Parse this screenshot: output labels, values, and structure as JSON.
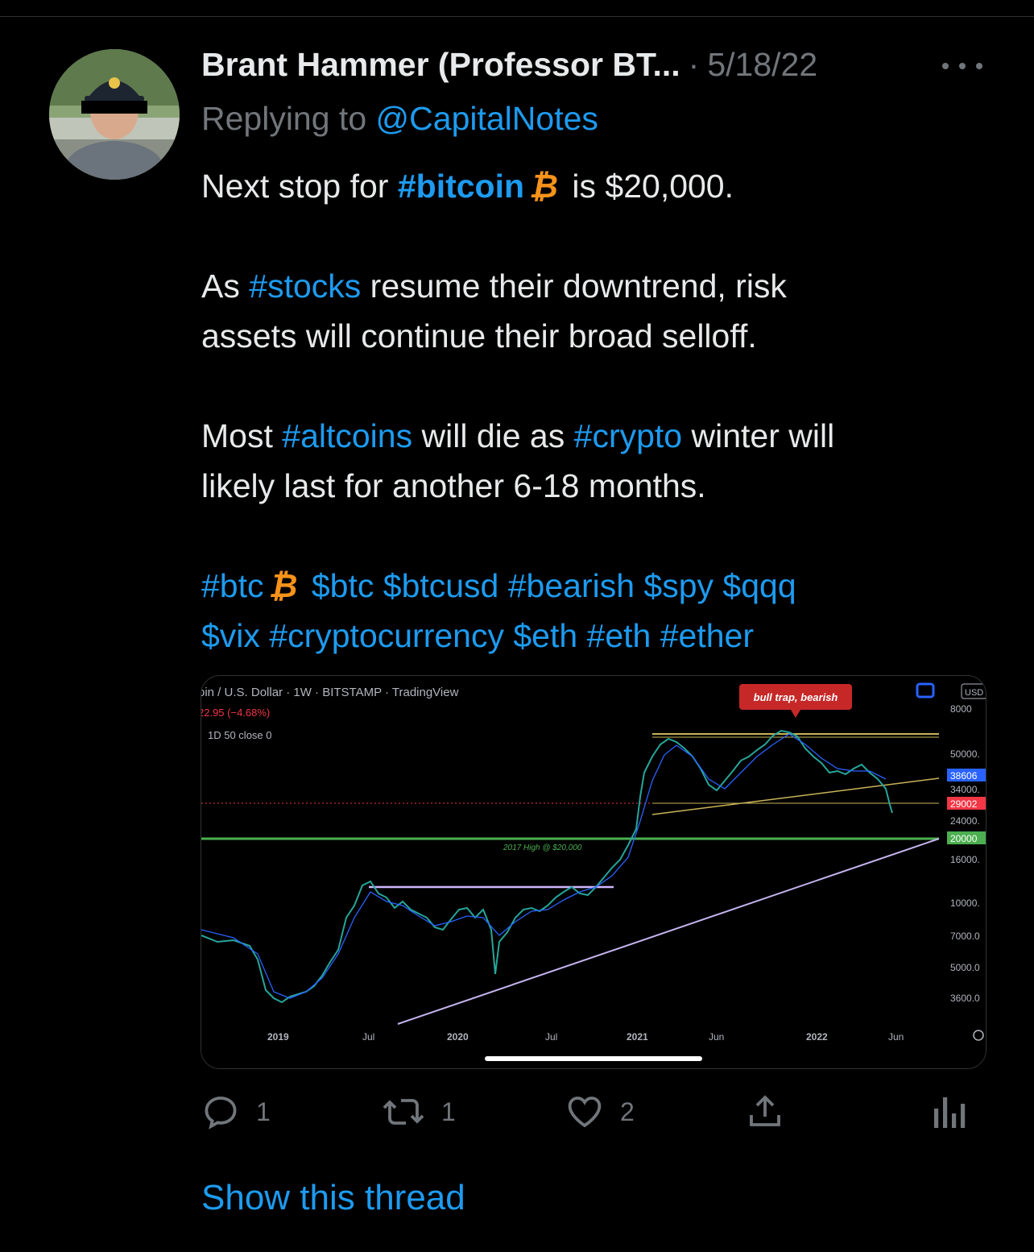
{
  "tweet": {
    "author_name": "Brant Hammer (Professor BT...",
    "separator": "·",
    "date": "5/18/22",
    "replying_prefix": "Replying to",
    "replying_handle": "@CapitalNotes",
    "line1": {
      "prefix": "Next stop for",
      "hashtag": "#bitcoin",
      "btc_glyph": "₿",
      "suffix": "is $20,000."
    },
    "para2": {
      "prefix": "As",
      "hashtag": "#stocks",
      "line_a_rest": "resume their downtrend, risk",
      "line_b": "assets will continue their broad selloff."
    },
    "para3": {
      "prefix": "Most",
      "hashtag1": "#altcoins",
      "middle": "will die as",
      "hashtag2": "#crypto",
      "line_a_rest": "winter will",
      "line_b": "likely last for another 6-18 months."
    },
    "tags_line1": {
      "tag1": "#btc",
      "btc_glyph": "₿",
      "rest": "$btc $btcusd #bearish $spy $qqq"
    },
    "tags_line2": "$vix #cryptocurrency $eth #eth #ether"
  },
  "chart_image": {
    "header_title": "oin / U.S. Dollar · 1W · BITSTAMP · TradingView",
    "header_change": "22.95 (−4.68%)",
    "indicator": "1D 50 close 0",
    "annotation_bull_trap": "bull trap, bearish",
    "annotation_2017_high": "2017 High @ $20,000",
    "currency_badge": "USD",
    "corner_label": "1W",
    "price_badges": [
      {
        "text": "38606",
        "color": "#2962ff"
      },
      {
        "text": "29002",
        "color": "#f23645"
      },
      {
        "text": "20000",
        "color": "#4caf50"
      }
    ],
    "axis_labels": [
      "8000",
      "50000.",
      "34000.",
      "24000.",
      "16000.",
      "10000.",
      "7000.0",
      "5000.0",
      "3600.0"
    ],
    "x_labels": [
      "2019",
      "Jul",
      "2020",
      "Jul",
      "2021",
      "Jun",
      "2022",
      "Jun"
    ]
  },
  "actions": {
    "reply_count": "1",
    "retweet_count": "1",
    "like_count": "2"
  },
  "show_thread": "Show this thread",
  "colors": {
    "link": "#1d9bf0",
    "muted": "#71767b",
    "btc_orange": "#f7931a"
  }
}
